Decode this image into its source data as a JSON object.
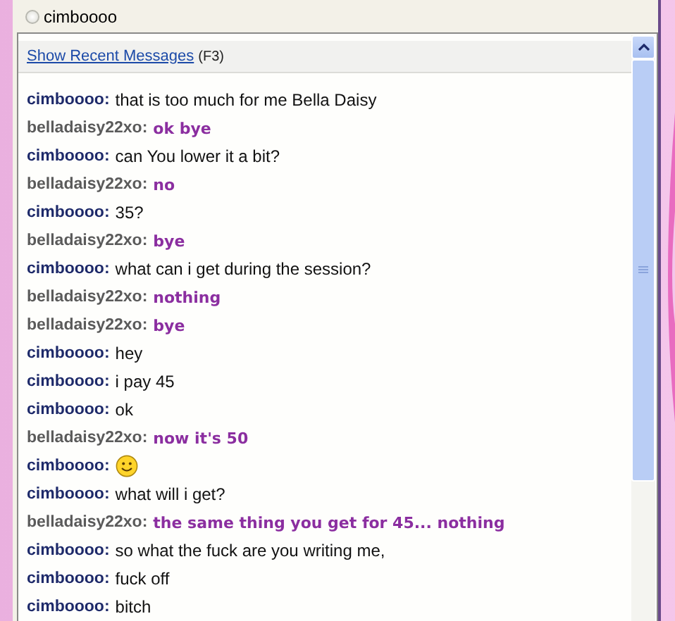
{
  "participant": {
    "name": "cimboooo",
    "selected": false
  },
  "chat": {
    "link": "Show Recent Messages",
    "shortcut": "(F3)",
    "messages": [
      {
        "kind": "text",
        "own": true,
        "sender": "cimboooo:",
        "text": "that is too much for me Bella Daisy"
      },
      {
        "kind": "text",
        "own": false,
        "sender": "belladaisy22xo:",
        "text": "ok bye"
      },
      {
        "kind": "text",
        "own": true,
        "sender": "cimboooo:",
        "text": "can You lower it a bit?"
      },
      {
        "kind": "text",
        "own": false,
        "sender": "belladaisy22xo:",
        "text": "no"
      },
      {
        "kind": "text",
        "own": true,
        "sender": "cimboooo:",
        "text": "35?"
      },
      {
        "kind": "text",
        "own": false,
        "sender": "belladaisy22xo:",
        "text": "bye"
      },
      {
        "kind": "text",
        "own": true,
        "sender": "cimboooo:",
        "text": "what can i get during the session?"
      },
      {
        "kind": "text",
        "own": false,
        "sender": "belladaisy22xo:",
        "text": "nothing"
      },
      {
        "kind": "text",
        "own": false,
        "sender": "belladaisy22xo:",
        "text": "bye"
      },
      {
        "kind": "text",
        "own": true,
        "sender": "cimboooo:",
        "text": "hey"
      },
      {
        "kind": "text",
        "own": true,
        "sender": "cimboooo:",
        "text": "i pay 45"
      },
      {
        "kind": "text",
        "own": true,
        "sender": "cimboooo:",
        "text": "ok"
      },
      {
        "kind": "text",
        "own": false,
        "sender": "belladaisy22xo:",
        "text": "now it's 50"
      },
      {
        "kind": "emoticon",
        "own": true,
        "sender": "cimboooo:"
      },
      {
        "kind": "text",
        "own": true,
        "sender": "cimboooo:",
        "text": "what will i get?"
      },
      {
        "kind": "text",
        "own": false,
        "sender": "belladaisy22xo:",
        "text": "the same thing you get for 45... nothing"
      },
      {
        "kind": "text",
        "own": true,
        "sender": "cimboooo:",
        "text": "so what the fuck are you writing me,"
      },
      {
        "kind": "text",
        "own": true,
        "sender": "cimboooo:",
        "text": "fuck off"
      },
      {
        "kind": "text",
        "own": true,
        "sender": "cimboooo:",
        "text": "bitch"
      }
    ]
  }
}
